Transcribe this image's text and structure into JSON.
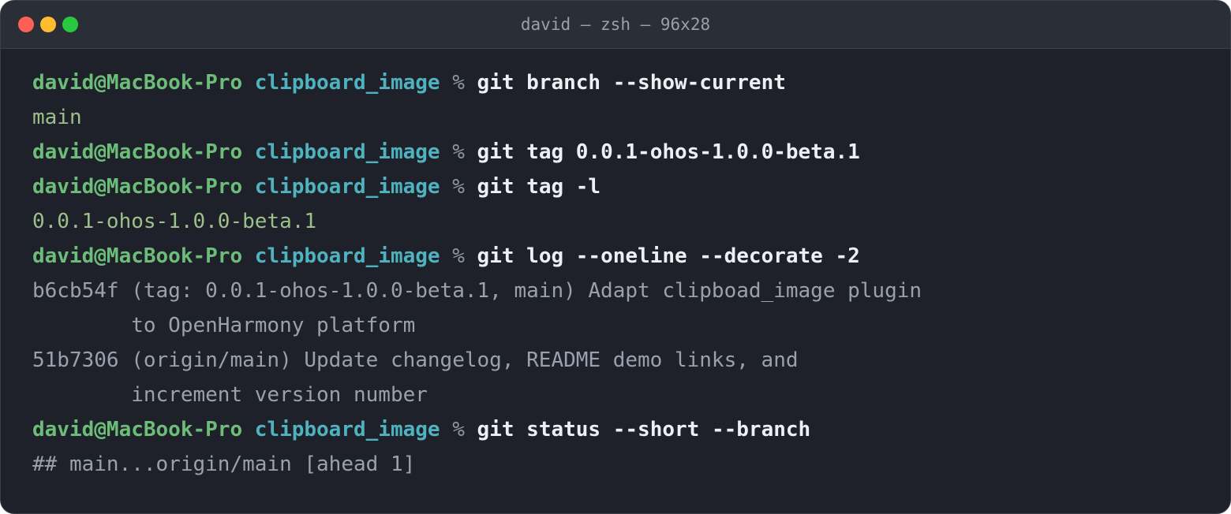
{
  "window": {
    "title": "david — zsh — 96x28"
  },
  "prompt": {
    "user": "david@MacBook-Pro",
    "dir": "clipboard_image",
    "symbol": "%"
  },
  "lines": [
    {
      "type": "cmd",
      "text": "git branch --show-current"
    },
    {
      "type": "out-green",
      "text": "main"
    },
    {
      "type": "cmd",
      "text": "git tag 0.0.1-ohos-1.0.0-beta.1"
    },
    {
      "type": "cmd",
      "text": "git tag -l"
    },
    {
      "type": "out-green",
      "text": "0.0.1-ohos-1.0.0-beta.1"
    },
    {
      "type": "cmd",
      "text": "git log --oneline --decorate -2"
    },
    {
      "type": "out-gray",
      "text": "b6cb54f (tag: 0.0.1-ohos-1.0.0-beta.1, main) Adapt clipboad_image plugin"
    },
    {
      "type": "out-gray",
      "text": "        to OpenHarmony platform"
    },
    {
      "type": "out-gray",
      "text": "51b7306 (origin/main) Update changelog, README demo links, and"
    },
    {
      "type": "out-gray",
      "text": "        increment version number"
    },
    {
      "type": "cmd",
      "text": "git status --short --branch"
    },
    {
      "type": "out-gray",
      "text": "## main...origin/main [ahead 1]"
    }
  ],
  "colors": {
    "background": "#1e2129",
    "titlebar": "#2a2e37",
    "user": "#6dbd7a",
    "dir": "#4fb3bf",
    "command": "#eceff4",
    "output_green": "#9cc08a",
    "output_gray": "#9ba1ac"
  }
}
